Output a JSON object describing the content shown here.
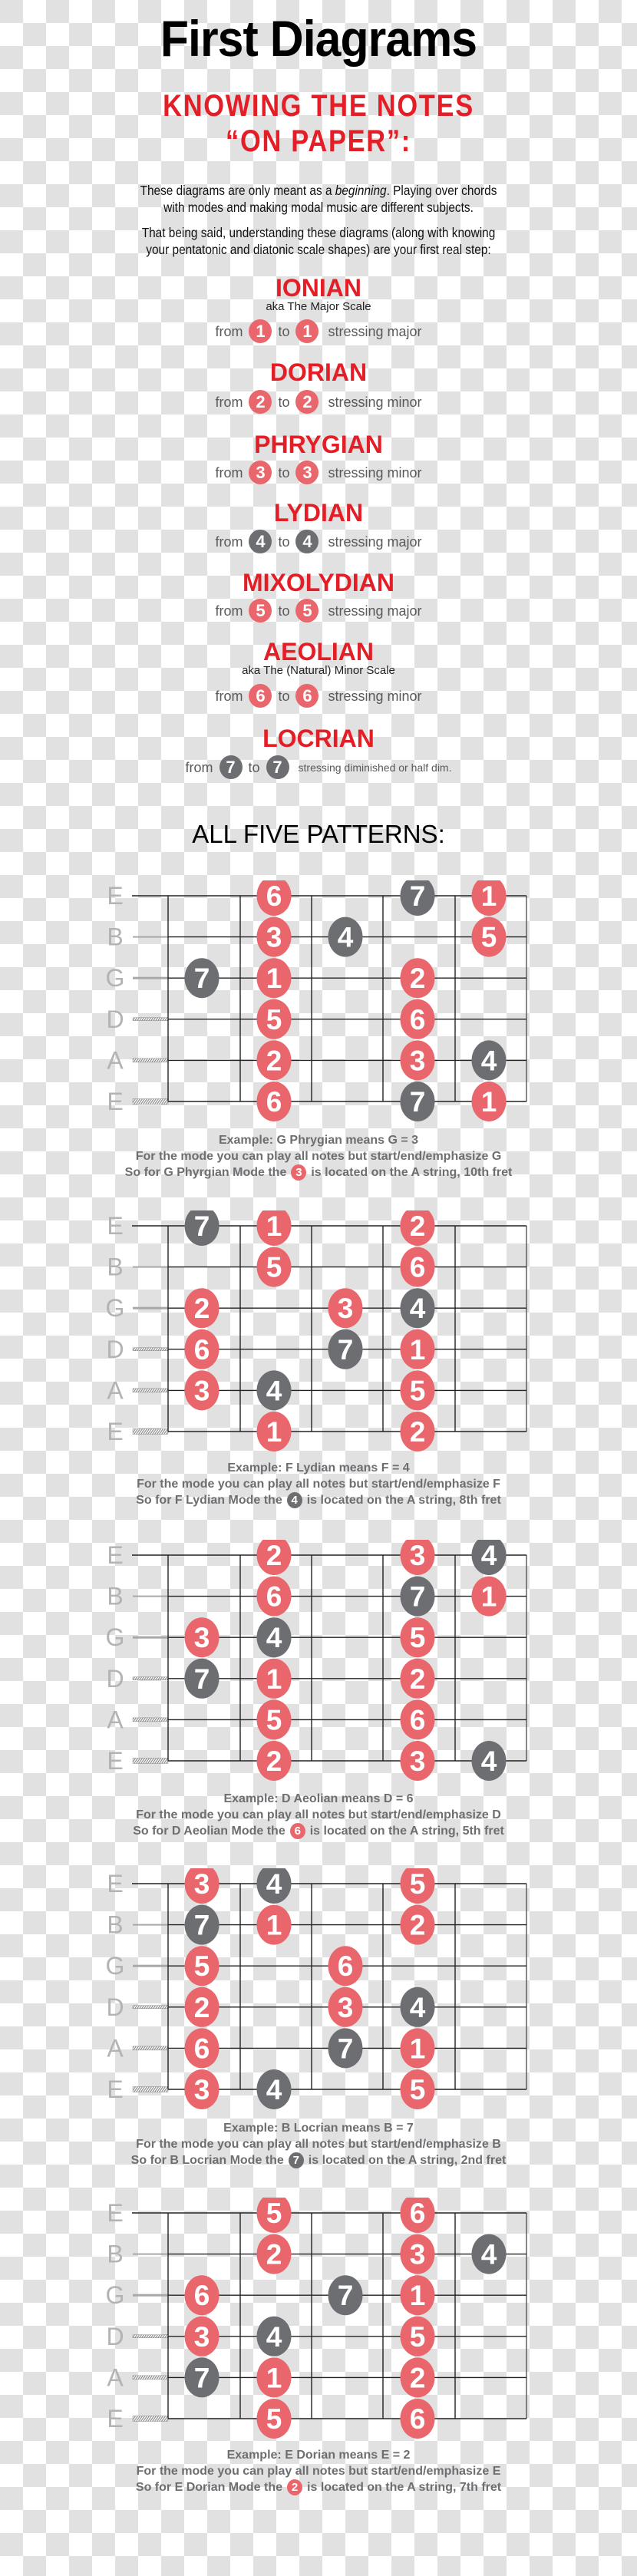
{
  "header": {
    "title": "First Diagrams",
    "subtitle_line1": "KNOWING THE NOTES",
    "subtitle_line2": "“ON PAPER”:"
  },
  "intro": {
    "p1_before": "These diagrams are only meant as a ",
    "p1_emphasis": "beginning",
    "p1_after": ". Playing over chords",
    "p1_line2": "with modes and making modal music are different subjects.",
    "p2_line1": "That being said, understanding these diagrams (along with knowing",
    "p2_line2": "your pentatonic and diatonic scale shapes) are your first real step:"
  },
  "colors": {
    "heading_red": "#e31e26",
    "degree_red": "#e9676c",
    "degree_dark": "#6d6e71",
    "caption_gray": "#6d6e71"
  },
  "modes": [
    {
      "name": "IONIAN",
      "aka": "aka The Major Scale",
      "from_word": "from",
      "to_word": "to",
      "degree": "1",
      "style": "red",
      "stressing": "stressing major"
    },
    {
      "name": "DORIAN",
      "aka": null,
      "from_word": "from",
      "to_word": "to",
      "degree": "2",
      "style": "red",
      "stressing": "stressing minor"
    },
    {
      "name": "PHRYGIAN",
      "aka": null,
      "from_word": "from",
      "to_word": "to",
      "degree": "3",
      "style": "red",
      "stressing": "stressing minor"
    },
    {
      "name": "LYDIAN",
      "aka": null,
      "from_word": "from",
      "to_word": "to",
      "degree": "4",
      "style": "dark",
      "stressing": "stressing major"
    },
    {
      "name": "MIXOLYDIAN",
      "aka": null,
      "from_word": "from",
      "to_word": "to",
      "degree": "5",
      "style": "red",
      "stressing": "stressing major"
    },
    {
      "name": "AEOLIAN",
      "aka": "aka The (Natural) Minor Scale",
      "from_word": "from",
      "to_word": "to",
      "degree": "6",
      "style": "red",
      "stressing": "stressing minor"
    },
    {
      "name": "LOCRIAN",
      "aka": null,
      "from_word": "from",
      "to_word": "to",
      "degree": "7",
      "style": "dark",
      "stressing": "stressing diminished or half dim."
    }
  ],
  "patterns_heading": "ALL FIVE PATTERNS:",
  "string_labels": [
    "E",
    "B",
    "G",
    "D",
    "A",
    "E"
  ],
  "dark_degrees": [
    "4",
    "7"
  ],
  "diagrams": [
    {
      "notes": [
        {
          "string": 0,
          "column": 2,
          "degree": "6"
        },
        {
          "string": 0,
          "column": 4,
          "degree": "7"
        },
        {
          "string": 0,
          "column": 5,
          "degree": "1"
        },
        {
          "string": 1,
          "column": 2,
          "degree": "3"
        },
        {
          "string": 1,
          "column": 3,
          "degree": "4"
        },
        {
          "string": 1,
          "column": 5,
          "degree": "5"
        },
        {
          "string": 2,
          "column": 1,
          "degree": "7"
        },
        {
          "string": 2,
          "column": 2,
          "degree": "1"
        },
        {
          "string": 2,
          "column": 4,
          "degree": "2"
        },
        {
          "string": 3,
          "column": 2,
          "degree": "5"
        },
        {
          "string": 3,
          "column": 4,
          "degree": "6"
        },
        {
          "string": 4,
          "column": 2,
          "degree": "2"
        },
        {
          "string": 4,
          "column": 4,
          "degree": "3"
        },
        {
          "string": 4,
          "column": 5,
          "degree": "4"
        },
        {
          "string": 5,
          "column": 2,
          "degree": "6"
        },
        {
          "string": 5,
          "column": 4,
          "degree": "7"
        },
        {
          "string": 5,
          "column": 5,
          "degree": "1"
        }
      ],
      "caption_line1": "Example: G Phrygian means G = 3",
      "caption_line2": "For the mode you can play all notes but start/end/emphasize G",
      "caption_line3_before": "So for G Phyrgian Mode the",
      "caption_degree": "3",
      "caption_line3_after": "is located on the A string, 10th fret"
    },
    {
      "notes": [
        {
          "string": 0,
          "column": 1,
          "degree": "7"
        },
        {
          "string": 0,
          "column": 2,
          "degree": "1"
        },
        {
          "string": 0,
          "column": 4,
          "degree": "2"
        },
        {
          "string": 1,
          "column": 2,
          "degree": "5"
        },
        {
          "string": 1,
          "column": 4,
          "degree": "6"
        },
        {
          "string": 2,
          "column": 1,
          "degree": "2"
        },
        {
          "string": 2,
          "column": 3,
          "degree": "3"
        },
        {
          "string": 2,
          "column": 4,
          "degree": "4"
        },
        {
          "string": 3,
          "column": 1,
          "degree": "6"
        },
        {
          "string": 3,
          "column": 3,
          "degree": "7"
        },
        {
          "string": 3,
          "column": 4,
          "degree": "1"
        },
        {
          "string": 4,
          "column": 1,
          "degree": "3"
        },
        {
          "string": 4,
          "column": 2,
          "degree": "4"
        },
        {
          "string": 4,
          "column": 4,
          "degree": "5"
        },
        {
          "string": 5,
          "column": 2,
          "degree": "1"
        },
        {
          "string": 5,
          "column": 4,
          "degree": "2"
        }
      ],
      "caption_line1": "Example: F Lydian means F = 4",
      "caption_line2": "For the mode you can play all notes but start/end/emphasize F",
      "caption_line3_before": "So for F Lydian Mode the",
      "caption_degree": "4",
      "caption_line3_after": "is located on the A string, 8th fret"
    },
    {
      "notes": [
        {
          "string": 0,
          "column": 2,
          "degree": "2"
        },
        {
          "string": 0,
          "column": 4,
          "degree": "3"
        },
        {
          "string": 0,
          "column": 5,
          "degree": "4"
        },
        {
          "string": 1,
          "column": 2,
          "degree": "6"
        },
        {
          "string": 1,
          "column": 4,
          "degree": "7"
        },
        {
          "string": 1,
          "column": 5,
          "degree": "1"
        },
        {
          "string": 2,
          "column": 1,
          "degree": "3"
        },
        {
          "string": 2,
          "column": 2,
          "degree": "4"
        },
        {
          "string": 2,
          "column": 4,
          "degree": "5"
        },
        {
          "string": 3,
          "column": 1,
          "degree": "7"
        },
        {
          "string": 3,
          "column": 2,
          "degree": "1"
        },
        {
          "string": 3,
          "column": 4,
          "degree": "2"
        },
        {
          "string": 4,
          "column": 2,
          "degree": "5"
        },
        {
          "string": 4,
          "column": 4,
          "degree": "6"
        },
        {
          "string": 5,
          "column": 2,
          "degree": "2"
        },
        {
          "string": 5,
          "column": 4,
          "degree": "3"
        },
        {
          "string": 5,
          "column": 5,
          "degree": "4"
        }
      ],
      "caption_line1": "Example: D Aeolian means D = 6",
      "caption_line2": "For the mode you can play all notes but start/end/emphasize D",
      "caption_line3_before": "So for D Aeolian Mode the",
      "caption_degree": "6",
      "caption_line3_after": "is located on the A string, 5th fret"
    },
    {
      "notes": [
        {
          "string": 0,
          "column": 1,
          "degree": "3"
        },
        {
          "string": 0,
          "column": 2,
          "degree": "4"
        },
        {
          "string": 0,
          "column": 4,
          "degree": "5"
        },
        {
          "string": 1,
          "column": 1,
          "degree": "7"
        },
        {
          "string": 1,
          "column": 2,
          "degree": "1"
        },
        {
          "string": 1,
          "column": 4,
          "degree": "2"
        },
        {
          "string": 2,
          "column": 1,
          "degree": "5"
        },
        {
          "string": 2,
          "column": 3,
          "degree": "6"
        },
        {
          "string": 3,
          "column": 1,
          "degree": "2"
        },
        {
          "string": 3,
          "column": 3,
          "degree": "3"
        },
        {
          "string": 3,
          "column": 4,
          "degree": "4"
        },
        {
          "string": 4,
          "column": 1,
          "degree": "6"
        },
        {
          "string": 4,
          "column": 3,
          "degree": "7"
        },
        {
          "string": 4,
          "column": 4,
          "degree": "1"
        },
        {
          "string": 5,
          "column": 1,
          "degree": "3"
        },
        {
          "string": 5,
          "column": 2,
          "degree": "4"
        },
        {
          "string": 5,
          "column": 4,
          "degree": "5"
        }
      ],
      "caption_line1": "Example: B Locrian means B = 7",
      "caption_line2": "For the mode you can play all notes but start/end/emphasize B",
      "caption_line3_before": "So for B Locrian Mode the",
      "caption_degree": "7",
      "caption_line3_after": "is located on the A string, 2nd fret"
    },
    {
      "notes": [
        {
          "string": 0,
          "column": 2,
          "degree": "5"
        },
        {
          "string": 0,
          "column": 4,
          "degree": "6"
        },
        {
          "string": 1,
          "column": 2,
          "degree": "2"
        },
        {
          "string": 1,
          "column": 4,
          "degree": "3"
        },
        {
          "string": 1,
          "column": 5,
          "degree": "4"
        },
        {
          "string": 2,
          "column": 1,
          "degree": "6"
        },
        {
          "string": 2,
          "column": 3,
          "degree": "7"
        },
        {
          "string": 2,
          "column": 4,
          "degree": "1"
        },
        {
          "string": 3,
          "column": 1,
          "degree": "3"
        },
        {
          "string": 3,
          "column": 2,
          "degree": "4"
        },
        {
          "string": 3,
          "column": 4,
          "degree": "5"
        },
        {
          "string": 4,
          "column": 1,
          "degree": "7"
        },
        {
          "string": 4,
          "column": 2,
          "degree": "1"
        },
        {
          "string": 4,
          "column": 4,
          "degree": "2"
        },
        {
          "string": 5,
          "column": 2,
          "degree": "5"
        },
        {
          "string": 5,
          "column": 4,
          "degree": "6"
        }
      ],
      "caption_line1": "Example: E Dorian means E = 2",
      "caption_line2": "For the mode you can play all notes but start/end/emphasize E",
      "caption_line3_before": "So for E Dorian Mode the",
      "caption_degree": "2",
      "caption_line3_after": "is located on the A string, 7th fret"
    }
  ]
}
